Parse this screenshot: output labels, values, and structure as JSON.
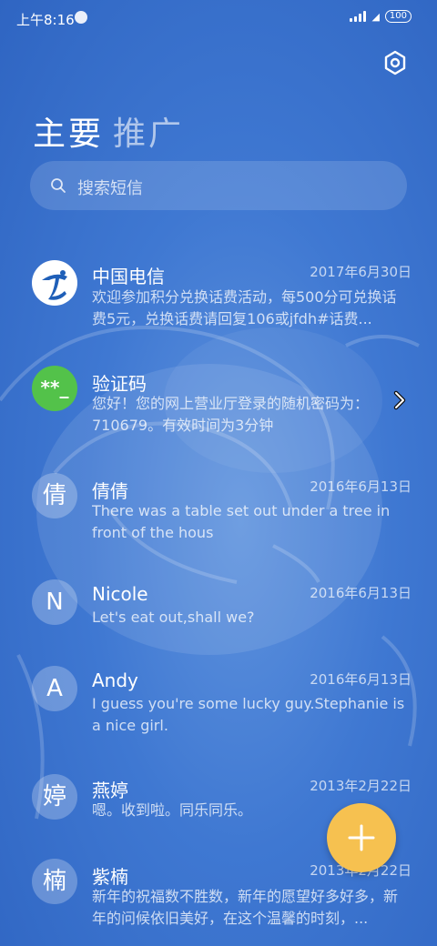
{
  "status_bar": {
    "time": "上午8:16",
    "battery": "100"
  },
  "tabs": {
    "main": "主要",
    "promo": "推广"
  },
  "search": {
    "placeholder": "搜索短信"
  },
  "messages": [
    {
      "avatar": "",
      "name": "中国电信",
      "date": "2017年6月30日",
      "preview": "欢迎参加积分兑换话费活动，每500分可兑换话费5元，兑换话费请回复106或jfdh#话费..."
    },
    {
      "avatar": "**_",
      "name": "验证码",
      "date": "",
      "preview": "您好！您的网上营业厅登录的随机密码为：710679。有效时间为3分钟"
    },
    {
      "avatar": "倩",
      "name": "倩倩",
      "date": "2016年6月13日",
      "preview": "There was a table set out under a tree in front of the hous"
    },
    {
      "avatar": "N",
      "name": "Nicole",
      "date": "2016年6月13日",
      "preview": "Let's eat out,shall we?"
    },
    {
      "avatar": "A",
      "name": "Andy",
      "date": "2016年6月13日",
      "preview": "I guess you're some lucky guy.Stephanie is a nice girl."
    },
    {
      "avatar": "婷",
      "name": "燕婷",
      "date": "2013年2月22日",
      "preview": "嗯。收到啦。同乐同乐。"
    },
    {
      "avatar": "楠",
      "name": "紫楠",
      "date": "2013年2月22日",
      "preview": "新年的祝福数不胜数，新年的愿望好多好多，新年的问候依旧美好，在这个温馨的时刻，..."
    }
  ],
  "colors": {
    "background": "#3f78d2",
    "fab": "#f6c150",
    "code_avatar": "#53c24a",
    "telecom_blue": "#1f5fb8"
  },
  "icons": {
    "settings": "hexagon-settings-icon",
    "search": "search-icon",
    "fab": "plus-icon",
    "chevron": "chevron-right-icon"
  }
}
